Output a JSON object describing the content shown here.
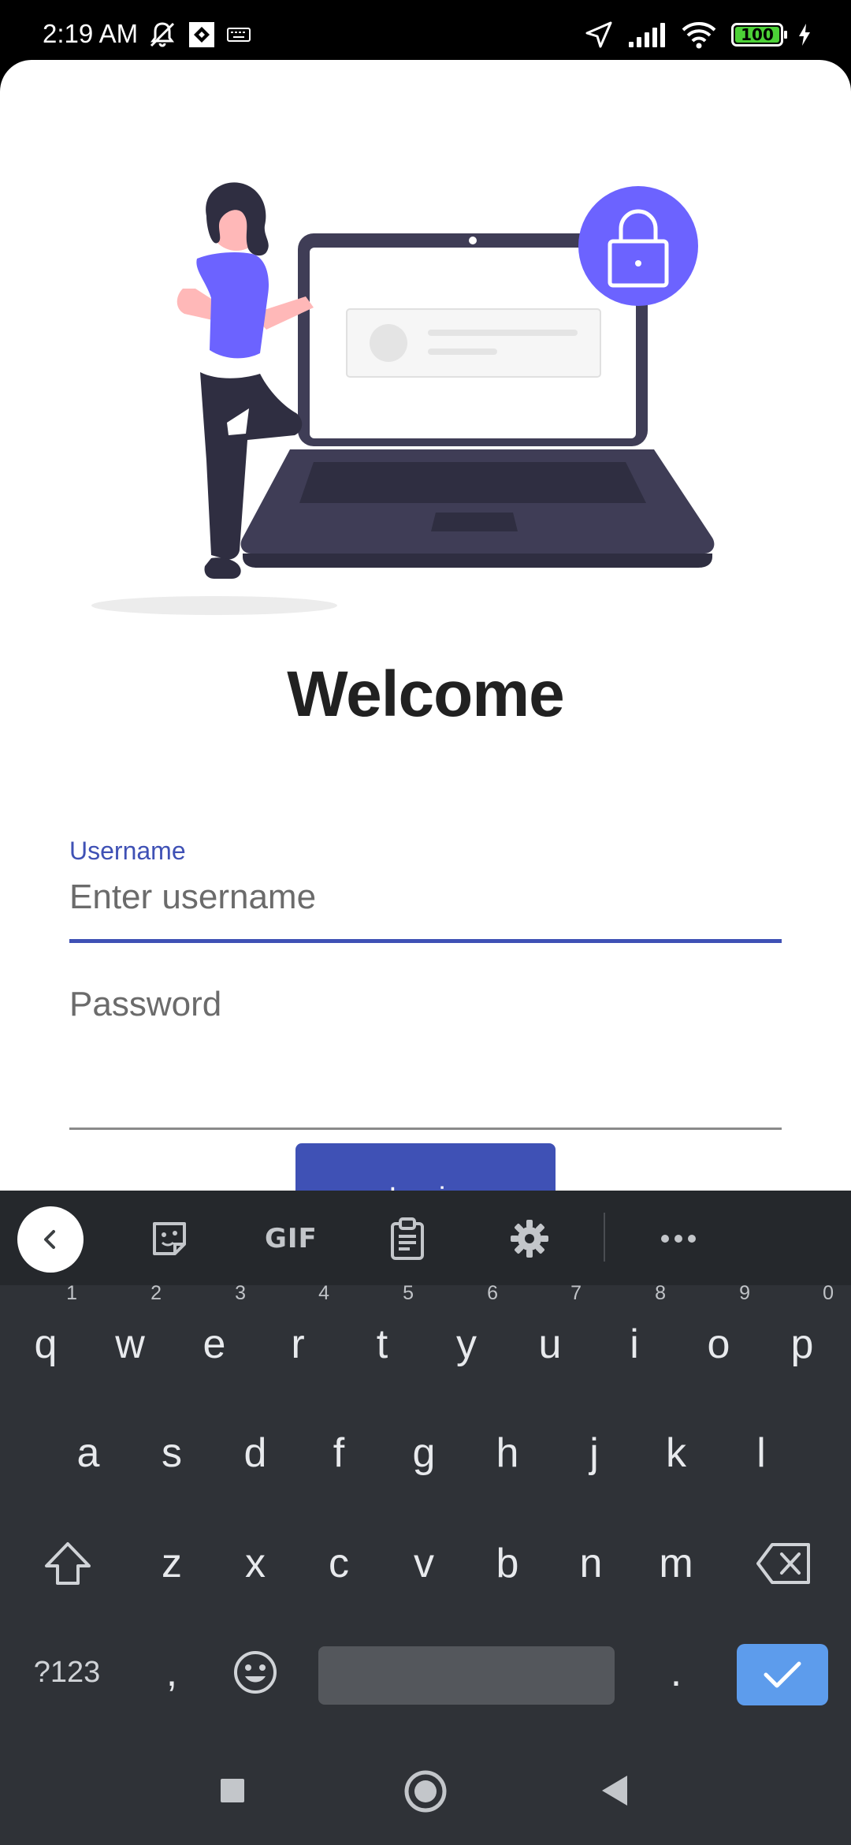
{
  "status_bar": {
    "time": "2:19 AM",
    "battery": "100",
    "icons": [
      "mute-icon",
      "screen-icon",
      "keyboard-icon",
      "location-icon",
      "signal-icon",
      "wifi-icon",
      "battery-icon",
      "charging-icon"
    ]
  },
  "screen": {
    "title": "Welcome",
    "username": {
      "label": "Username",
      "placeholder": "Enter username",
      "value": ""
    },
    "password": {
      "placeholder": "Password",
      "value": ""
    },
    "login_label": "Login"
  },
  "keyboard": {
    "toolbar": {
      "gif_label": "GIF",
      "icons": [
        "chevron-left-icon",
        "sticker-icon",
        "gif-icon",
        "clipboard-icon",
        "gear-icon",
        "more-icon"
      ]
    },
    "row1": [
      {
        "k": "q",
        "n": "1"
      },
      {
        "k": "w",
        "n": "2"
      },
      {
        "k": "e",
        "n": "3"
      },
      {
        "k": "r",
        "n": "4"
      },
      {
        "k": "t",
        "n": "5"
      },
      {
        "k": "y",
        "n": "6"
      },
      {
        "k": "u",
        "n": "7"
      },
      {
        "k": "i",
        "n": "8"
      },
      {
        "k": "o",
        "n": "9"
      },
      {
        "k": "p",
        "n": "0"
      }
    ],
    "row2": [
      "a",
      "s",
      "d",
      "f",
      "g",
      "h",
      "j",
      "k",
      "l"
    ],
    "row3": [
      "z",
      "x",
      "c",
      "v",
      "b",
      "n",
      "m"
    ],
    "row4": {
      "symbols": "?123",
      "comma": ",",
      "period": "."
    }
  },
  "colors": {
    "accent": "#3f51b5",
    "illustration_accent": "#6c63ff",
    "keyboard_bg": "#2f3237",
    "enter_key": "#5d9cec"
  }
}
